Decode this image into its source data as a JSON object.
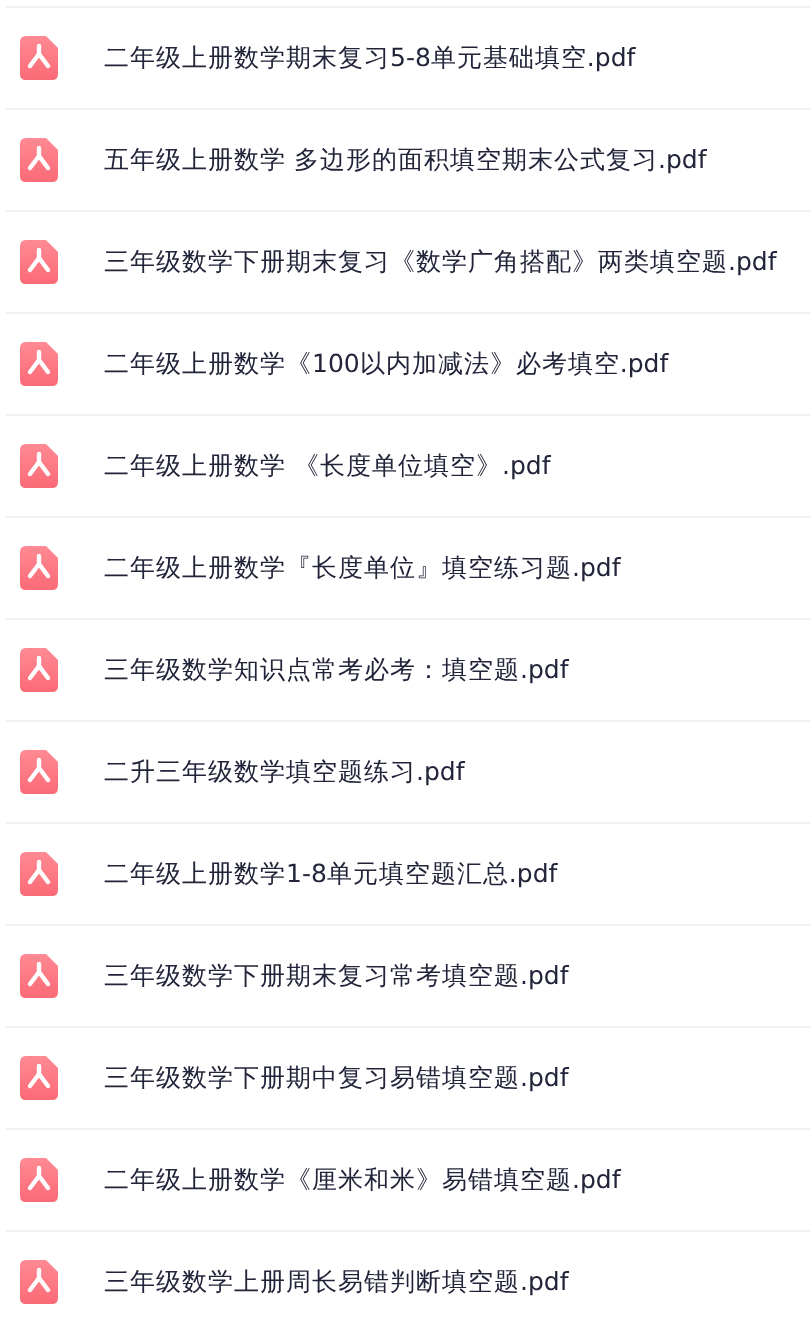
{
  "files": [
    {
      "name": "二年级上册数学期末复习5-8单元基础填空.pdf"
    },
    {
      "name": "五年级上册数学 多边形的面积填空期末公式复习.pdf"
    },
    {
      "name": "三年级数学下册期末复习《数学广角搭配》两类填空题.pdf"
    },
    {
      "name": "二年级上册数学《100以内加减法》必考填空.pdf"
    },
    {
      "name": "二年级上册数学 《长度单位填空》.pdf"
    },
    {
      "name": "二年级上册数学『长度单位』填空练习题.pdf"
    },
    {
      "name": "三年级数学知识点常考必考：填空题.pdf"
    },
    {
      "name": "二升三年级数学填空题练习.pdf"
    },
    {
      "name": "二年级上册数学1-8单元填空题汇总.pdf"
    },
    {
      "name": "三年级数学下册期末复习常考填空题.pdf"
    },
    {
      "name": "三年级数学下册期中复习易错填空题.pdf"
    },
    {
      "name": "二年级上册数学《厘米和米》易错填空题.pdf"
    },
    {
      "name": "三年级数学上册周长易错判断填空题.pdf"
    }
  ]
}
